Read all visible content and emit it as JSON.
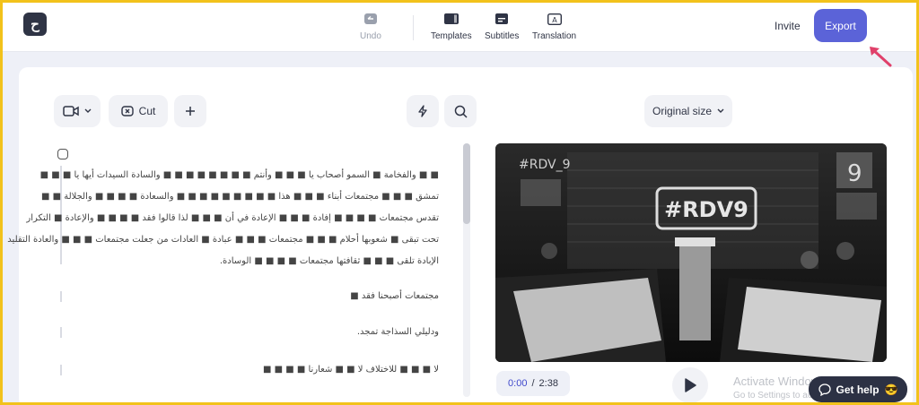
{
  "app": {
    "logo_glyph": "ح"
  },
  "toolbar": {
    "undo_label": "Undo",
    "templates_label": "Templates",
    "subtitles_label": "Subtitles",
    "translation_label": "Translation",
    "invite_label": "Invite",
    "export_label": "Export"
  },
  "editor": {
    "cut_label": "Cut",
    "size_label": "Original size",
    "transcript": [
      {
        "lines": [
          "■ ■ والفخامة ■ السمو أصحاب يا ■ ■ ■ وأنتم ■ ■ ■ ■ ■ ■ ■ ■ والسادة السيدات أيها يا ■ ■ ■",
          "تمشق ■ ■ ■ مجتمعات أبناء ■ ■ ■ هذا ■ ■ ■ ■ ■ ■ ■ ■ ■ والسعادة ■ ■ ■ ■ والجلالة ■ ■",
          "تقدس مجتمعات ■ ■ ■ ■ إفادة ■ ■ ■ الإعادة في أن ■ ■ ■ لذا قالوا فقد ■ ■ ■ ■ والإعادة ■ التكرار",
          "تحت تبقى ■ شعوبها أحلام ■ ■ ■ مجتمعات ■ ■ ■ عبادة ■ العادات من جعلت مجتمعات ■ ■ ■ والعادة التقليد",
          "الإبادة تلقى ■ ■ ■ ثقافتها مجتمعات ■ ■ ■ ■ الوسادة."
        ]
      },
      {
        "lines": [
          "مجتمعات أصبحنا فقد ■"
        ]
      },
      {
        "lines": [
          "ودليلي السذاجة تمجد."
        ]
      },
      {
        "lines": [
          "لا ■ ■ ■ للاختلاف لا ■ ■ شعارنا ■ ■ ■ ■"
        ]
      }
    ]
  },
  "player": {
    "current_time": "0:00",
    "separator": "/",
    "duration": "2:38",
    "video_overlay_text": "#RDV_9",
    "logo_text": "#RDV9",
    "corner_number": "9"
  },
  "os_watermark": {
    "line1": "Activate Windows",
    "line2": "Go to Settings to activate Windows."
  },
  "help": {
    "label": "Get help",
    "emoji": "😎"
  },
  "colors": {
    "accent": "#5b63d8",
    "frame": "#f2c21b",
    "arrow": "#e0406a"
  }
}
